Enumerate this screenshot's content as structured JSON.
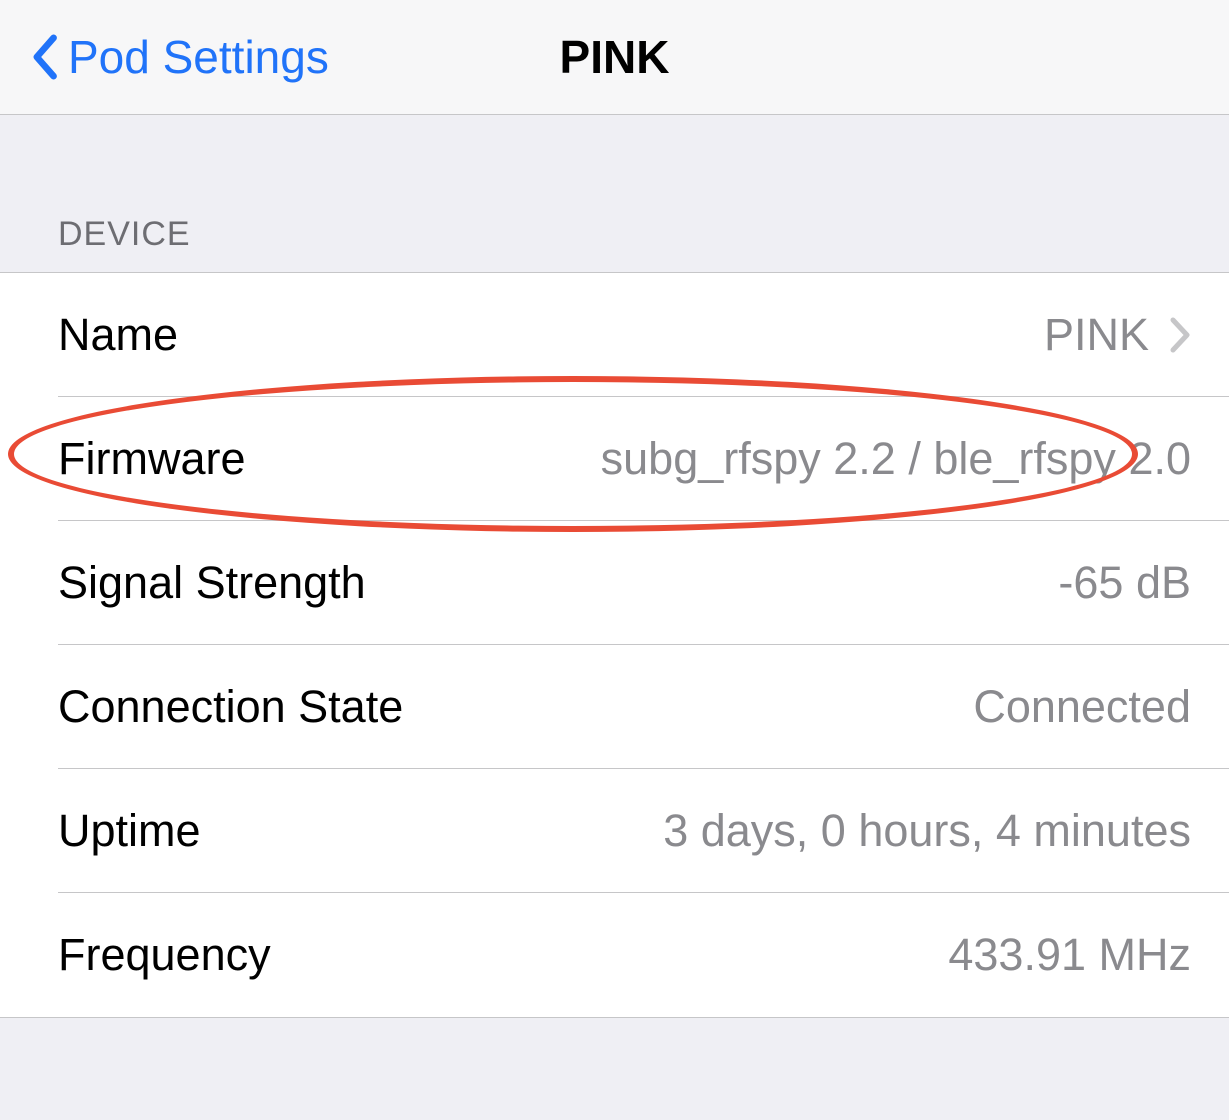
{
  "nav": {
    "back_label": "Pod Settings",
    "title": "PINK"
  },
  "section": {
    "header": "Device"
  },
  "rows": {
    "name": {
      "label": "Name",
      "value": "PINK"
    },
    "firmware": {
      "label": "Firmware",
      "value": "subg_rfspy 2.2 / ble_rfspy 2.0"
    },
    "signal": {
      "label": "Signal Strength",
      "value": "-65 dB"
    },
    "connection": {
      "label": "Connection State",
      "value": "Connected"
    },
    "uptime": {
      "label": "Uptime",
      "value": "3 days, 0 hours, 4 minutes"
    },
    "frequency": {
      "label": "Frequency",
      "value": "433.91 MHz"
    }
  },
  "annotation": {
    "highlight": "firmware-row"
  }
}
